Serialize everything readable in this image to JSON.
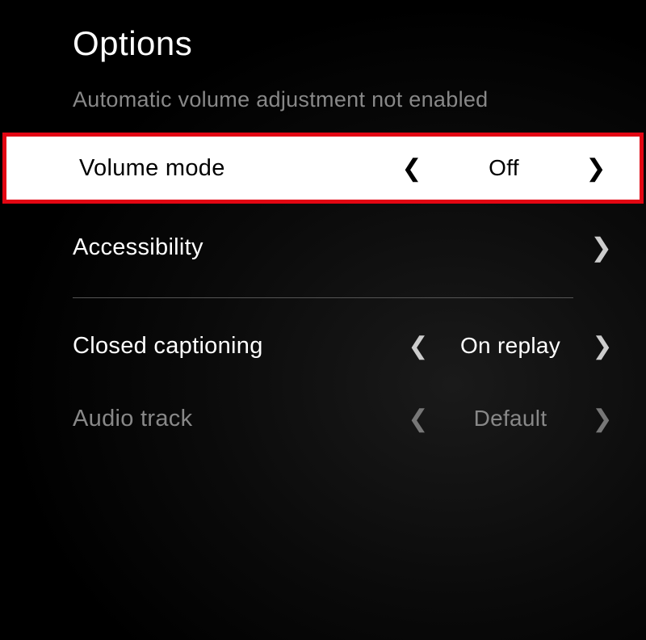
{
  "header": {
    "title": "Options",
    "subtitle": "Automatic volume adjustment not enabled"
  },
  "rows": {
    "volume_mode": {
      "label": "Volume mode",
      "value": "Off"
    },
    "accessibility": {
      "label": "Accessibility"
    },
    "closed_captioning": {
      "label": "Closed captioning",
      "value": "On replay"
    },
    "audio_track": {
      "label": "Audio track",
      "value": "Default"
    }
  }
}
